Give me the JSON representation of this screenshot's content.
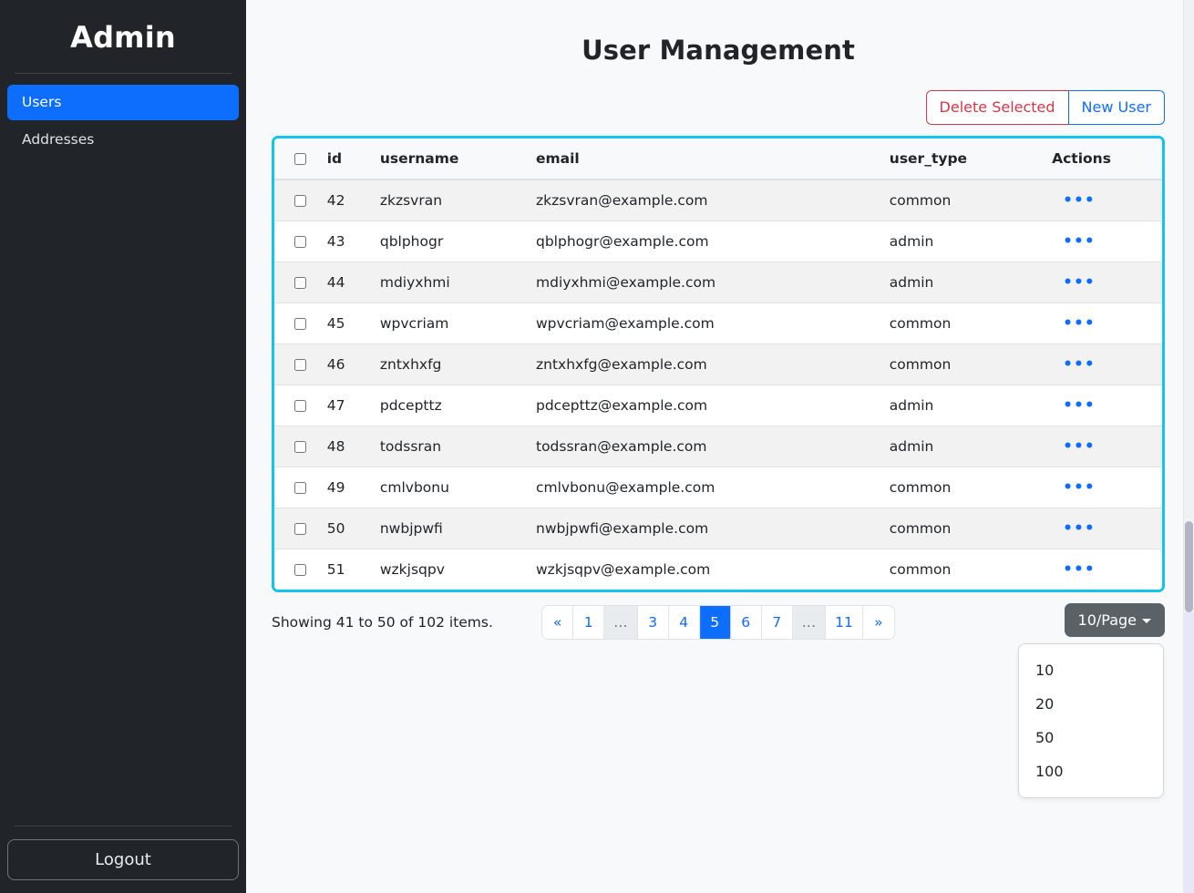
{
  "sidebar": {
    "brand": "Admin",
    "items": [
      {
        "label": "Users",
        "active": true
      },
      {
        "label": "Addresses",
        "active": false
      }
    ],
    "logout_label": "Logout"
  },
  "header": {
    "title": "User Management"
  },
  "toolbar": {
    "delete_selected_label": "Delete Selected",
    "new_user_label": "New User"
  },
  "table": {
    "columns": [
      "",
      "id",
      "username",
      "email",
      "user_type",
      "Actions"
    ],
    "action_glyph": "•••",
    "rows": [
      {
        "id": "42",
        "username": "zkzsvran",
        "email": "zkzsvran@example.com",
        "user_type": "common"
      },
      {
        "id": "43",
        "username": "qblphogr",
        "email": "qblphogr@example.com",
        "user_type": "admin"
      },
      {
        "id": "44",
        "username": "mdiyxhmi",
        "email": "mdiyxhmi@example.com",
        "user_type": "admin"
      },
      {
        "id": "45",
        "username": "wpvcriam",
        "email": "wpvcriam@example.com",
        "user_type": "common"
      },
      {
        "id": "46",
        "username": "zntxhxfg",
        "email": "zntxhxfg@example.com",
        "user_type": "common"
      },
      {
        "id": "47",
        "username": "pdcepttz",
        "email": "pdcepttz@example.com",
        "user_type": "admin"
      },
      {
        "id": "48",
        "username": "todssran",
        "email": "todssran@example.com",
        "user_type": "admin"
      },
      {
        "id": "49",
        "username": "cmlvbonu",
        "email": "cmlvbonu@example.com",
        "user_type": "common"
      },
      {
        "id": "50",
        "username": "nwbjpwfi",
        "email": "nwbjpwfi@example.com",
        "user_type": "common"
      },
      {
        "id": "51",
        "username": "wzkjsqpv",
        "email": "wzkjsqpv@example.com",
        "user_type": "common"
      }
    ]
  },
  "footer": {
    "showing_text": "Showing 41 to 50 of 102 items.",
    "pagination": [
      {
        "label": "«",
        "state": "normal"
      },
      {
        "label": "1",
        "state": "normal"
      },
      {
        "label": "…",
        "state": "disabled"
      },
      {
        "label": "3",
        "state": "normal"
      },
      {
        "label": "4",
        "state": "normal"
      },
      {
        "label": "5",
        "state": "active"
      },
      {
        "label": "6",
        "state": "normal"
      },
      {
        "label": "7",
        "state": "normal"
      },
      {
        "label": "…",
        "state": "disabled"
      },
      {
        "label": "11",
        "state": "normal"
      },
      {
        "label": "»",
        "state": "normal"
      }
    ],
    "per_page": {
      "selected_label": "10/Page",
      "options": [
        "10",
        "20",
        "50",
        "100"
      ],
      "open": true
    }
  },
  "colors": {
    "sidebar_bg": "#212529",
    "accent_primary": "#0d6efd",
    "danger": "#dc3545",
    "table_highlight_border": "#14c3ee",
    "secondary": "#5a6268"
  }
}
